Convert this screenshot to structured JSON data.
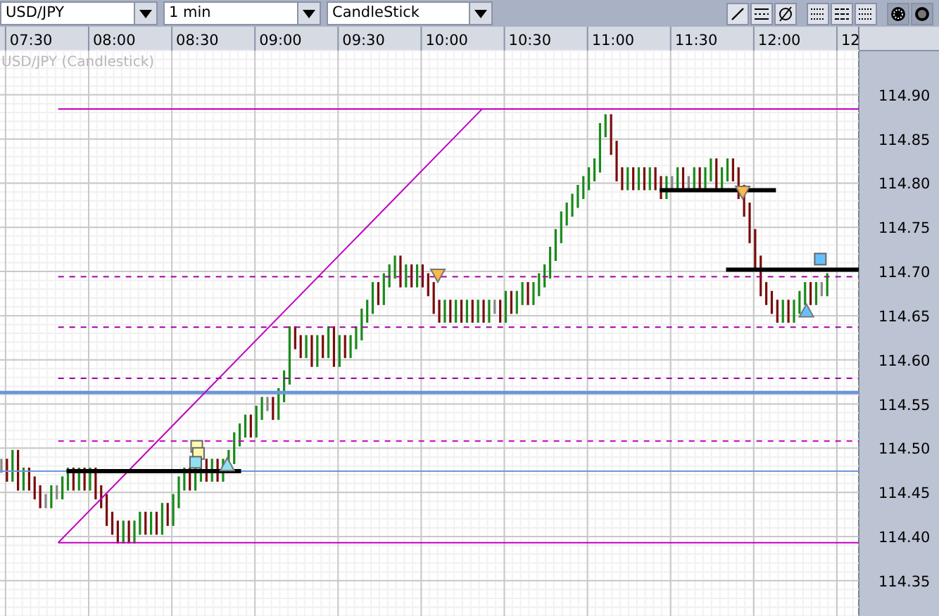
{
  "toolbar": {
    "symbol": "USD/JPY",
    "interval": "1 min",
    "chart_type": "CandleStick"
  },
  "chart": {
    "title": "USD/JPY (Candlestick)",
    "time_labels": [
      "07:30",
      "08:00",
      "08:30",
      "09:00",
      "09:30",
      "10:00",
      "10:30",
      "11:00",
      "11:30",
      "12:00",
      "12"
    ],
    "price_labels": [
      "114.90",
      "114.85",
      "114.80",
      "114.75",
      "114.70",
      "114.65",
      "114.60",
      "114.55",
      "114.50",
      "114.45",
      "114.40",
      "114.35"
    ]
  }
}
